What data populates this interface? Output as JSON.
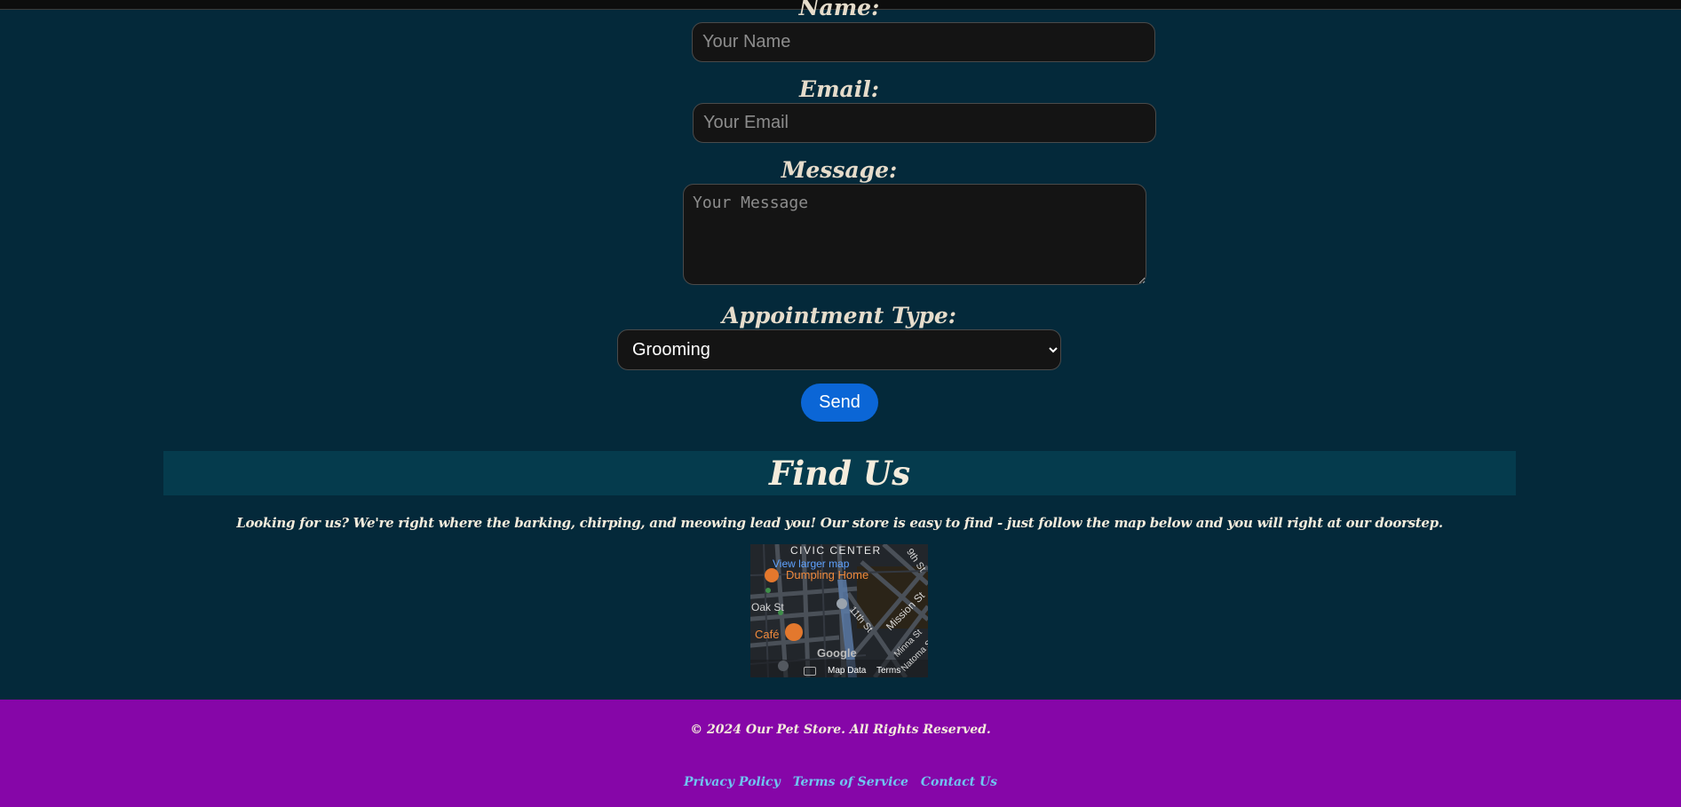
{
  "form": {
    "name_label": "Name:",
    "name_placeholder": "Your Name",
    "email_label": "Email:",
    "email_placeholder": "Your Email",
    "message_label": "Message:",
    "message_placeholder": "Your Message",
    "appointment_label": "Appointment Type:",
    "appointment_selected": "Grooming",
    "send_label": "Send"
  },
  "find_us": {
    "title": "Find Us",
    "text": "Looking for us? We're right where the barking, chirping, and meowing lead you! Our store is easy to find - just follow the map below and you will right at our doorstep."
  },
  "map": {
    "link": "View larger map",
    "area_label": "CIVIC CENTER",
    "poi_1": "Dumpling Home",
    "poi_2": "Café",
    "street_oak": "Oak St",
    "street_11th": "11th St",
    "street_mission": "Mission St",
    "street_minna": "Minna St",
    "street_natoma": "Natoma St",
    "street_9th": "9th St",
    "google": "Google",
    "map_data": "Map Data",
    "terms": "Terms"
  },
  "footer": {
    "copyright": "© 2024 Our Pet Store. All Rights Reserved.",
    "links": [
      "Privacy Policy",
      "Terms of Service",
      "Contact Us"
    ]
  },
  "colors": {
    "page_bg": "#04293a",
    "section_bar": "#053b4d",
    "footer_bg": "#8606a8",
    "send_button": "#0b66d6",
    "link": "#6fc4f0"
  }
}
